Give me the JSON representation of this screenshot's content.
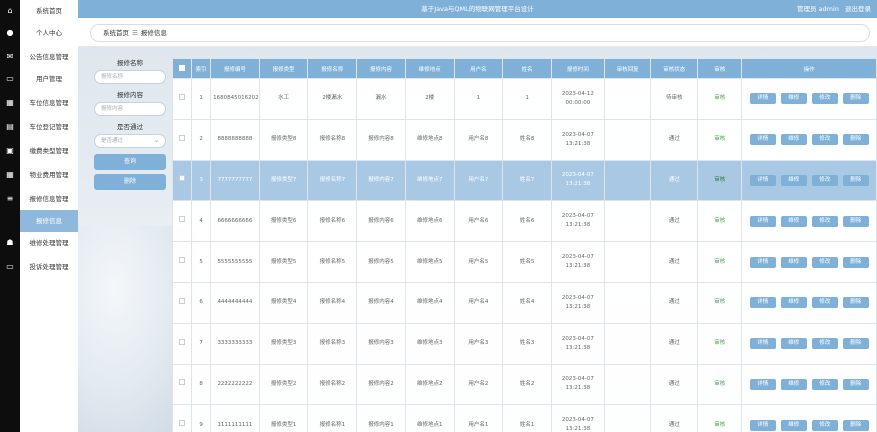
{
  "sidebar": {
    "items": [
      {
        "label": "系统首页",
        "icon": "home-icon"
      },
      {
        "label": "个人中心",
        "icon": "person-icon"
      },
      {
        "label": "公告信息管理",
        "icon": "mail-icon"
      },
      {
        "label": "用户管理",
        "icon": "monitor-icon"
      },
      {
        "label": "车位信息管理",
        "icon": "grid-icon"
      },
      {
        "label": "车位登记管理",
        "icon": "book-icon"
      },
      {
        "label": "缴费类型管理",
        "icon": "lock-icon"
      },
      {
        "label": "物业费用管理",
        "icon": "grid-icon"
      },
      {
        "label": "报修信息管理",
        "icon": "list-icon"
      },
      {
        "label": "报修信息",
        "icon": ""
      },
      {
        "label": "维修处理管理",
        "icon": "thumb-icon"
      },
      {
        "label": "投诉处理管理",
        "icon": "monitor-icon"
      }
    ]
  },
  "header": {
    "title": "基于Java与QML的物联网管理平台设计",
    "user_label": "管理员 admin",
    "logout_label": "退出登录"
  },
  "breadcrumb": {
    "home": "系统首页",
    "separator": "☰",
    "current": "报修信息"
  },
  "search": {
    "name_label": "报修名称",
    "name_placeholder": "报修名称",
    "content_label": "报修内容",
    "content_placeholder": "报修内容",
    "pass_label": "是否通过",
    "pass_placeholder": "是否通过",
    "query_button": "查询",
    "delete_button": "删除"
  },
  "table": {
    "headers": [
      "索引",
      "报修编号",
      "报修类型",
      "报修名称",
      "报修内容",
      "维修地点",
      "用户名",
      "姓名",
      "报修时间",
      "审核回复",
      "审核状态",
      "审核",
      "操作"
    ],
    "actions": {
      "detail": "详情",
      "repair": "维修",
      "edit": "修改",
      "delete": "删除"
    },
    "audit_link": "审核",
    "rows": [
      {
        "index": "1",
        "code": "1680845016202",
        "type": "水工",
        "name": "2楼漏水",
        "content": "漏水",
        "place": "2楼",
        "username": "1",
        "realname": "1",
        "time": "2023-04-12 00:00:00",
        "reply": "",
        "status": "待审核"
      },
      {
        "index": "2",
        "code": "8888888888",
        "type": "报修类型8",
        "name": "报修名称8",
        "content": "报修内容8",
        "place": "维修地点8",
        "username": "用户名8",
        "realname": "姓名8",
        "time": "2023-04-07 13:21:38",
        "reply": "",
        "status": "通过"
      },
      {
        "index": "3",
        "code": "7777777777",
        "type": "报修类型7",
        "name": "报修名称7",
        "content": "报修内容7",
        "place": "维修地点7",
        "username": "用户名7",
        "realname": "姓名7",
        "time": "2023-04-07 13:21:38",
        "reply": "",
        "status": "通过"
      },
      {
        "index": "4",
        "code": "6666666666",
        "type": "报修类型6",
        "name": "报修名称6",
        "content": "报修内容6",
        "place": "维修地点6",
        "username": "用户名6",
        "realname": "姓名6",
        "time": "2023-04-07 13:21:38",
        "reply": "",
        "status": "通过"
      },
      {
        "index": "5",
        "code": "5555555555",
        "type": "报修类型5",
        "name": "报修名称5",
        "content": "报修内容5",
        "place": "维修地点5",
        "username": "用户名5",
        "realname": "姓名5",
        "time": "2023-04-07 13:21:38",
        "reply": "",
        "status": "通过"
      },
      {
        "index": "6",
        "code": "4444444444",
        "type": "报修类型4",
        "name": "报修名称4",
        "content": "报修内容4",
        "place": "维修地点4",
        "username": "用户名4",
        "realname": "姓名4",
        "time": "2023-04-07 13:21:38",
        "reply": "",
        "status": "通过"
      },
      {
        "index": "7",
        "code": "3333333333",
        "type": "报修类型3",
        "name": "报修名称3",
        "content": "报修内容3",
        "place": "维修地点3",
        "username": "用户名3",
        "realname": "姓名3",
        "time": "2023-04-07 13:21:38",
        "reply": "",
        "status": "通过"
      },
      {
        "index": "8",
        "code": "2222222222",
        "type": "报修类型2",
        "name": "报修名称2",
        "content": "报修内容2",
        "place": "维修地点2",
        "username": "用户名2",
        "realname": "姓名2",
        "time": "2023-04-07 13:21:38",
        "reply": "",
        "status": "通过"
      },
      {
        "index": "9",
        "code": "1111111111",
        "type": "报修类型1",
        "name": "报修名称1",
        "content": "报修内容1",
        "place": "维修地点1",
        "username": "用户名1",
        "realname": "姓名1",
        "time": "2023-04-07 13:21:38",
        "reply": "",
        "status": "通过"
      }
    ],
    "selected_row": "3"
  },
  "colors": {
    "accent": "#7fb0d8",
    "selected_row": "#a8c8e4",
    "audit_link": "#4ca14c",
    "icon_strip": "#0d0d0d"
  }
}
